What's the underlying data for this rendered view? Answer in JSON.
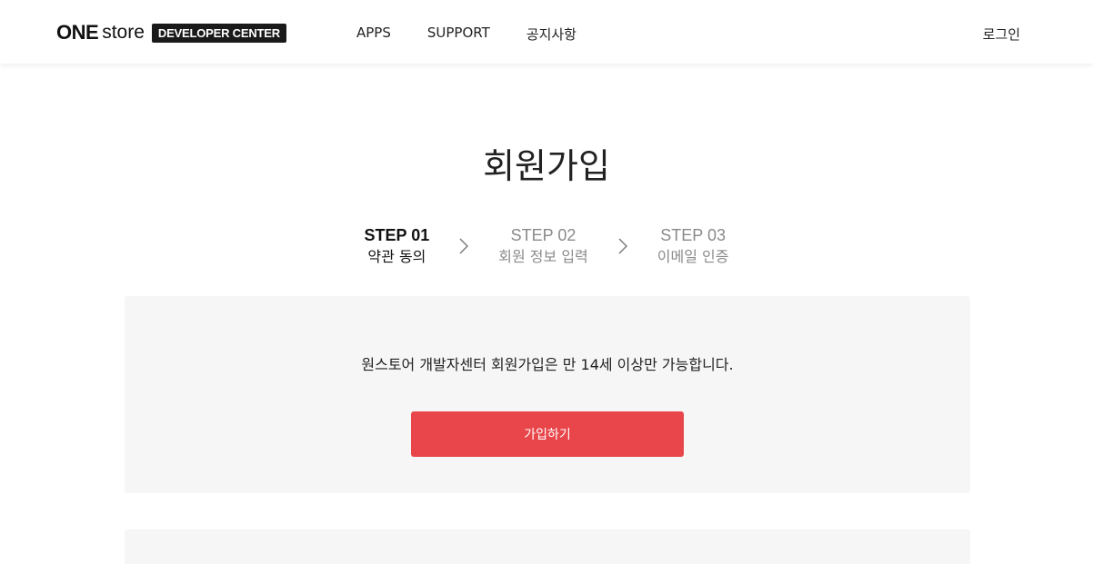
{
  "header": {
    "logo": {
      "one": "ONE",
      "store": "store",
      "badge": "DEVELOPER CENTER"
    },
    "nav": [
      {
        "label": "APPS"
      },
      {
        "label": "SUPPORT"
      },
      {
        "label": "공지사항"
      }
    ],
    "login_label": "로그인"
  },
  "main": {
    "title": "회원가입",
    "steps": [
      {
        "num": "STEP 01",
        "label": "약관 동의",
        "active": true
      },
      {
        "num": "STEP 02",
        "label": "회원 정보 입력",
        "active": false
      },
      {
        "num": "STEP 03",
        "label": "이메일 인증",
        "active": false
      }
    ],
    "notice": "원스토어 개발자센터 회원가입은 만 14세 이상만 가능합니다.",
    "join_button_label": "가입하기"
  },
  "colors": {
    "accent": "#e8464a",
    "panel_bg": "#f6f6f6",
    "inactive_text": "#8a8a8a"
  },
  "icons": {
    "step_separator": "chevron-right-icon"
  }
}
